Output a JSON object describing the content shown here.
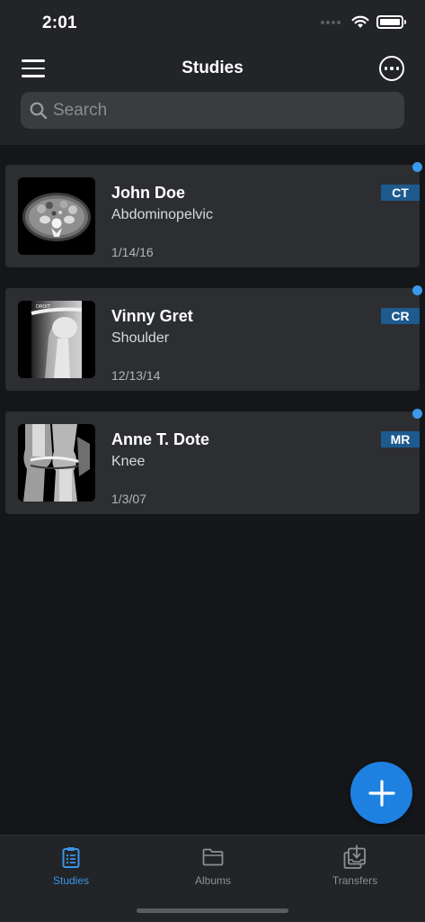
{
  "status_bar": {
    "time": "2:01"
  },
  "header": {
    "title": "Studies",
    "menu_icon": "hamburger-icon",
    "more_icon": "ellipsis-circle-icon"
  },
  "search": {
    "placeholder": "Search",
    "value": ""
  },
  "studies": [
    {
      "name": "John Doe",
      "region": "Abdominopelvic",
      "date": "1/14/16",
      "modality": "CT",
      "unread": true
    },
    {
      "name": "Vinny Gret",
      "region": "Shoulder",
      "date": "12/13/14",
      "modality": "CR",
      "unread": true,
      "thumb_text": "DROIT"
    },
    {
      "name": "Anne T. Dote",
      "region": "Knee",
      "date": "1/3/07",
      "modality": "MR",
      "unread": true
    }
  ],
  "tabs": [
    {
      "label": "Studies",
      "icon": "clipboard-list-icon",
      "active": true
    },
    {
      "label": "Albums",
      "icon": "folder-icon",
      "active": false
    },
    {
      "label": "Transfers",
      "icon": "tray-download-icon",
      "active": false
    }
  ],
  "colors": {
    "accent": "#1e80e0",
    "tab_active": "#3a94e8",
    "badge": "#1d5a8e",
    "unread_dot": "#3a99ee",
    "card": "#2c2e32",
    "background": "#141619"
  }
}
